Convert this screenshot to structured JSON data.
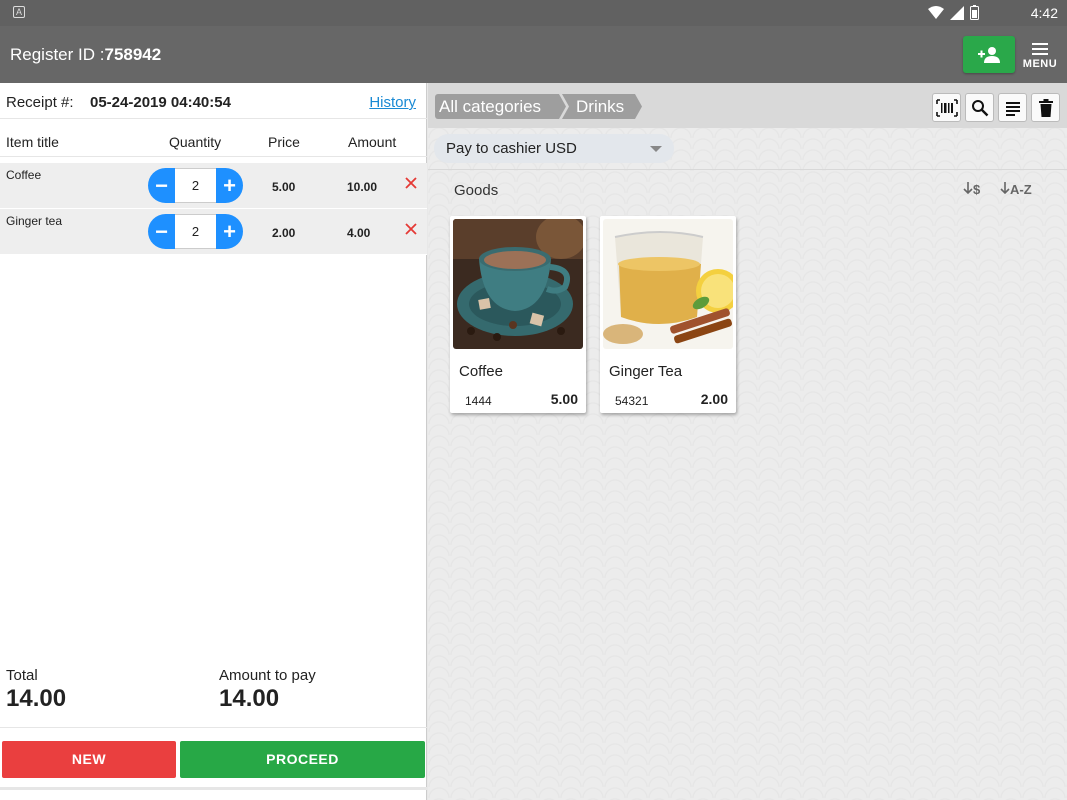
{
  "status_bar": {
    "time": "4:42",
    "app_letter": "A"
  },
  "app_bar": {
    "register_label": "Register ID :",
    "register_id": "758942",
    "menu_label": "MENU",
    "accent_green": "#2aa84a"
  },
  "receipt": {
    "label": "Receipt #:",
    "number": "05-24-2019 04:40:54",
    "history_link": "History"
  },
  "columns": {
    "item_title": "Item title",
    "quantity": "Quantity",
    "price": "Price",
    "amount": "Amount"
  },
  "items": [
    {
      "title": "Coffee",
      "quantity": "2",
      "price": "5.00",
      "amount": "10.00"
    },
    {
      "title": "Ginger tea",
      "quantity": "2",
      "price": "2.00",
      "amount": "4.00"
    }
  ],
  "totals": {
    "total_label": "Total",
    "total_value": "14.00",
    "pay_label": "Amount to pay",
    "pay_value": "14.00"
  },
  "actions": {
    "new_label": "NEW",
    "proceed_label": "PROCEED",
    "new_color": "#ea3f3f",
    "proceed_color": "#27a846"
  },
  "catalog": {
    "breadcrumbs": [
      "All categories",
      "Drinks"
    ],
    "tools": [
      "barcode-icon",
      "search-icon",
      "list-icon",
      "trash-icon"
    ],
    "payment_method": "Pay to cashier USD",
    "section_label": "Goods",
    "sort_price_label": "$",
    "sort_name_label": "A-Z",
    "products": [
      {
        "name": "Coffee",
        "code": "1444",
        "price": "5.00"
      },
      {
        "name": "Ginger Tea",
        "code": "54321",
        "price": "2.00"
      }
    ]
  }
}
